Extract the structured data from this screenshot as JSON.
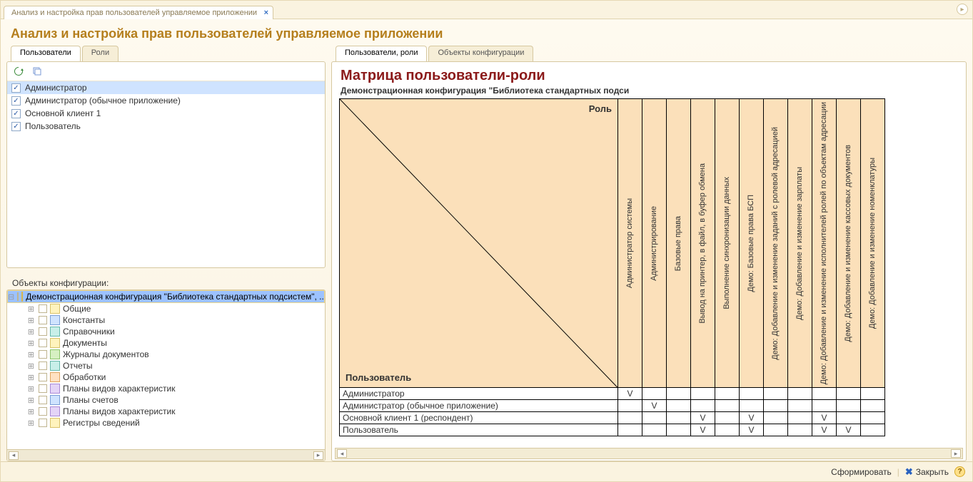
{
  "window": {
    "tab_title": "Анализ и настройка прав пользователей управляемое приложении"
  },
  "page_title": "Анализ и настройка прав пользователей управляемое приложении",
  "left_tabs": {
    "users": "Пользователи",
    "roles": "Роли"
  },
  "users": [
    {
      "label": "Администратор",
      "checked": true,
      "selected": true
    },
    {
      "label": "Администратор (обычное приложение)",
      "checked": true,
      "selected": false
    },
    {
      "label": "Основной клиент 1",
      "checked": true,
      "selected": false
    },
    {
      "label": "Пользователь",
      "checked": true,
      "selected": false
    }
  ],
  "config_section_label": "Объекты конфигурации:",
  "config_root": "Демонстрационная конфигурация \"Библиотека стандартных подсистем\", ...",
  "config_items": [
    {
      "label": "Общие",
      "icon": "ci-yellow"
    },
    {
      "label": "Константы",
      "icon": "ci-blue"
    },
    {
      "label": "Справочники",
      "icon": "ci-teal"
    },
    {
      "label": "Документы",
      "icon": "ci-yellow"
    },
    {
      "label": "Журналы документов",
      "icon": "ci-green"
    },
    {
      "label": "Отчеты",
      "icon": "ci-teal"
    },
    {
      "label": "Обработки",
      "icon": "ci-orange"
    },
    {
      "label": "Планы видов характеристик",
      "icon": "ci-purple"
    },
    {
      "label": "Планы счетов",
      "icon": "ci-blue"
    },
    {
      "label": "Планы видов характеристик",
      "icon": "ci-purple"
    },
    {
      "label": "Регистры сведений",
      "icon": "ci-yellow"
    }
  ],
  "right_tabs": {
    "users_roles": "Пользователи, роли",
    "config_objects": "Объекты конфигурации"
  },
  "matrix": {
    "title": "Матрица пользователи-роли",
    "subtitle": "Демонстрационная конфигурация \"Библиотека стандартных подси",
    "role_label": "Роль",
    "user_label": "Пользователь",
    "columns": [
      "Администратор системы",
      "Администрирование",
      "Базовые права",
      "Вывод на принтер, в файл, в буфер обмена",
      "Выполнение синхронизации данных",
      "Демо: Базовые права БСП",
      "Демо: Добавление и изменение заданий с ролевой адресацией",
      "Демо: Добавление и изменение зарплаты",
      "Демо: Добавление и изменение исполнителей ролей по объектам адресации",
      "Демо: Добавление и изменение кассовых документов",
      "Демо: Добавление и изменение номенклатуры"
    ],
    "rows": [
      {
        "label": "Администратор",
        "cells": [
          "V",
          "",
          "",
          "",
          "",
          "",
          "",
          "",
          "",
          "",
          ""
        ]
      },
      {
        "label": "Администратор (обычное приложение)",
        "cells": [
          "",
          "V",
          "",
          "",
          "",
          "",
          "",
          "",
          "",
          "",
          ""
        ]
      },
      {
        "label": "Основной клиент 1 (респондент)",
        "cells": [
          "",
          "",
          "",
          "V",
          "",
          "V",
          "",
          "",
          "V",
          "",
          ""
        ]
      },
      {
        "label": "Пользователь",
        "cells": [
          "",
          "",
          "",
          "V",
          "",
          "V",
          "",
          "",
          "V",
          "V",
          ""
        ]
      }
    ]
  },
  "buttons": {
    "generate": "Сформировать",
    "close": "Закрыть"
  }
}
